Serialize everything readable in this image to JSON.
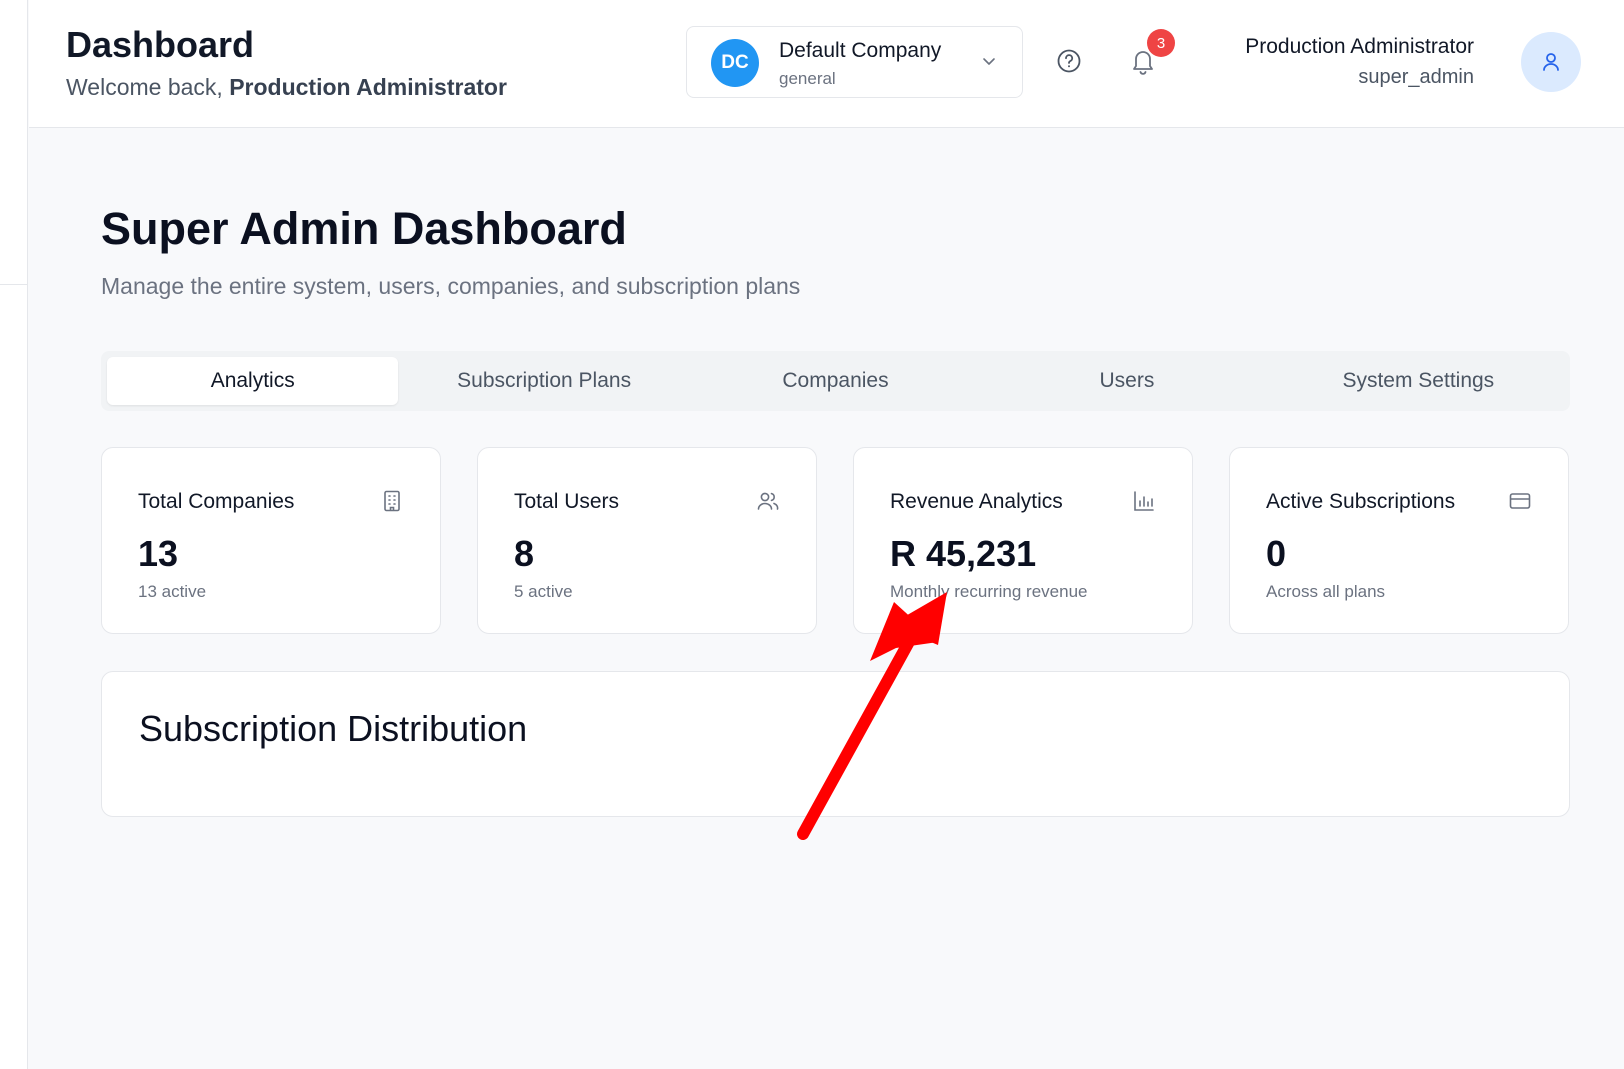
{
  "header": {
    "title": "Dashboard",
    "welcome_prefix": "Welcome back,",
    "welcome_name": "Production Administrator"
  },
  "company_switcher": {
    "initials": "DC",
    "name": "Default Company",
    "type": "general"
  },
  "notifications": {
    "count": "3"
  },
  "user": {
    "name": "Production Administrator",
    "role": "super_admin"
  },
  "page": {
    "title": "Super Admin Dashboard",
    "subtitle": "Manage the entire system, users, companies, and subscription plans"
  },
  "tabs": [
    {
      "label": "Analytics",
      "active": true
    },
    {
      "label": "Subscription Plans",
      "active": false
    },
    {
      "label": "Companies",
      "active": false
    },
    {
      "label": "Users",
      "active": false
    },
    {
      "label": "System Settings",
      "active": false
    }
  ],
  "stats": [
    {
      "label": "Total Companies",
      "value": "13",
      "note": "13 active",
      "icon": "building-icon"
    },
    {
      "label": "Total Users",
      "value": "8",
      "note": "5 active",
      "icon": "users-icon"
    },
    {
      "label": "Revenue Analytics",
      "value": "R 45,231",
      "note": "Monthly recurring revenue",
      "icon": "bar-chart-icon"
    },
    {
      "label": "Active Subscriptions",
      "value": "0",
      "note": "Across all plans",
      "icon": "credit-card-icon"
    }
  ],
  "distribution": {
    "title": "Subscription Distribution"
  },
  "colors": {
    "accent": "#2196f3",
    "badge": "#ef4444",
    "annotation": "#ff0000"
  }
}
